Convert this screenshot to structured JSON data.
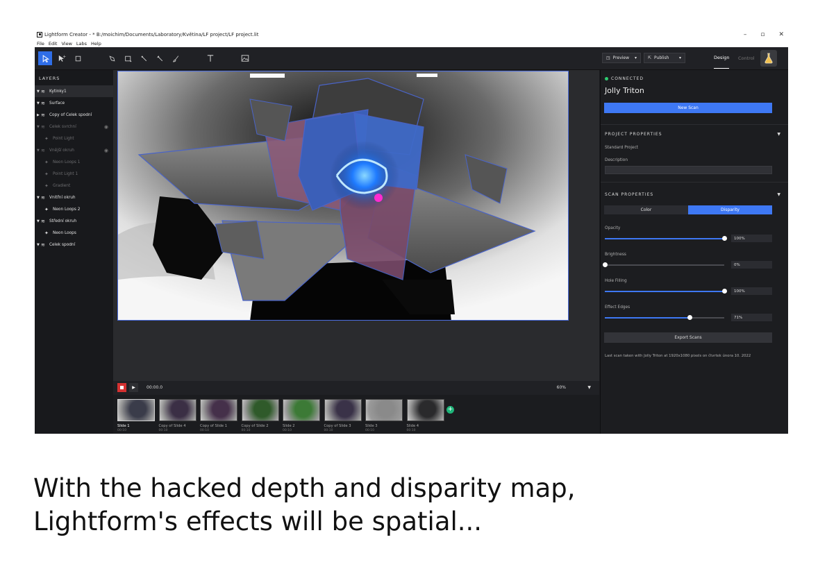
{
  "window": {
    "title": "Lightform Creator - * B:/moichim/Documents/Laboratory/Květina/LF project/LF project.lit",
    "controls": [
      "–",
      "▫",
      "✕"
    ]
  },
  "menu": [
    "File",
    "Edit",
    "View",
    "Labs",
    "Help"
  ],
  "toolbar": {
    "tools": [
      "select-tool",
      "point-select-tool",
      "crop-tool",
      "pen-tool",
      "rectangle-tool",
      "magic-wand-tool",
      "brush-select-tool",
      "brush-tool",
      "text-tool",
      "image-tool"
    ],
    "preview_label": "Preview",
    "publish_label": "Publish",
    "tab_design": "Design",
    "tab_control": "Control"
  },
  "layers": {
    "title": "LAYERS",
    "items": [
      {
        "label": "Kytinky1",
        "level": 0,
        "selected": true,
        "dim": false
      },
      {
        "label": "Surface",
        "level": 0,
        "selected": false,
        "dim": false
      },
      {
        "label": "Copy of Celek spodní",
        "level": 0,
        "selected": false,
        "dim": false
      },
      {
        "label": "Celek svrchní",
        "level": 0,
        "selected": false,
        "dim": true,
        "eye": true
      },
      {
        "label": "Point Light",
        "level": 1,
        "selected": false,
        "dim": true
      },
      {
        "label": "Vnější okruh",
        "level": 0,
        "selected": false,
        "dim": true,
        "eye": true
      },
      {
        "label": "Neon Loops 1",
        "level": 1,
        "selected": false,
        "dim": true
      },
      {
        "label": "Point Light 1",
        "level": 1,
        "selected": false,
        "dim": true
      },
      {
        "label": "Gradient",
        "level": 1,
        "selected": false,
        "dim": true
      },
      {
        "label": "Vnitřní okruh",
        "level": 0,
        "selected": false,
        "dim": false
      },
      {
        "label": "Neon Loops 2",
        "level": 1,
        "selected": false,
        "dim": false
      },
      {
        "label": "Střední okruh",
        "level": 0,
        "selected": false,
        "dim": false
      },
      {
        "label": "Neon Loops",
        "level": 1,
        "selected": false,
        "dim": false
      },
      {
        "label": "Celek spodní",
        "level": 0,
        "selected": false,
        "dim": false
      }
    ]
  },
  "timeline": {
    "time": "00:00.0",
    "zoom": "60%",
    "slides": [
      {
        "label": "Slide 1",
        "time": "00:10",
        "color": "#3a3c4a"
      },
      {
        "label": "Copy of Slide 4",
        "time": "00:10",
        "color": "#3b2f45"
      },
      {
        "label": "Copy of Slide 1",
        "time": "00:10",
        "color": "#45304a"
      },
      {
        "label": "Copy of Slide 2",
        "time": "00:10",
        "color": "#2f5a2a"
      },
      {
        "label": "Slide 2",
        "time": "00:10",
        "color": "#3c7a36"
      },
      {
        "label": "Copy of Slide 3",
        "time": "00:10",
        "color": "#3a3248"
      },
      {
        "label": "Slide 3",
        "time": "00:10",
        "color": "#8a8a8a"
      },
      {
        "label": "Slide 4",
        "time": "00:10",
        "color": "#2a2a2c"
      }
    ]
  },
  "right": {
    "status": "CONNECTED",
    "device": "Jolly Triton",
    "new_scan": "New Scan",
    "project_props": "PROJECT PROPERTIES",
    "project_type": "Standard Project",
    "description_label": "Description",
    "scan_props": "SCAN PROPERTIES",
    "seg_color": "Color",
    "seg_disparity": "Disparity",
    "opacity_label": "Opacity",
    "opacity_value": "100%",
    "opacity_level": 1.0,
    "brightness_label": "Brightness",
    "brightness_value": "0%",
    "brightness_level": 0.0,
    "hole_label": "Hole Filling",
    "hole_value": "100%",
    "hole_level": 1.0,
    "edges_label": "Effect Edges",
    "edges_value": "71%",
    "edges_level": 0.71,
    "export": "Export Scans",
    "last_scan": "Last scan taken with Jolly Triton at 1920x1080 pixels on čtvrtek února 10. 2022"
  },
  "caption": "With the hacked depth and disparity map,\nLightform's effects will be spatial..."
}
